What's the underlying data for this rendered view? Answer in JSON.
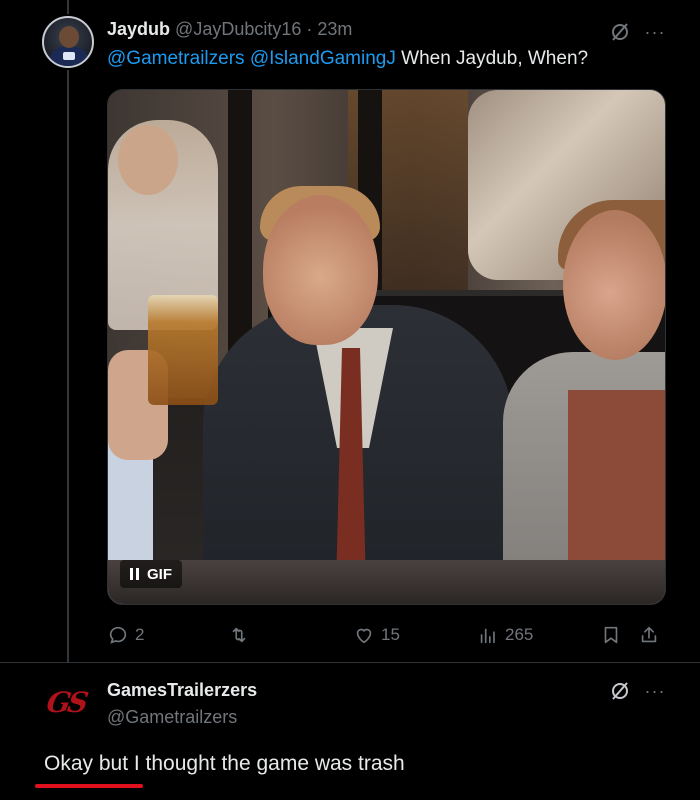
{
  "tweet": {
    "author_name": "Jaydub",
    "author_handle": "@JayDubcity16",
    "separator": "·",
    "time": "23m",
    "mentions": [
      "@Gametrailzers",
      "@IslandGamingJ"
    ],
    "text": "When Jaydub, When?",
    "media": {
      "type": "gif",
      "badge_label": "GIF",
      "control_icon": "pause-icon"
    },
    "actions": {
      "replies": "2",
      "reposts": "",
      "likes": "15",
      "views": "265"
    }
  },
  "reply": {
    "author_name": "GamesTrailerzers",
    "author_handle": "@Gametrailzers",
    "avatar_text": "GS",
    "text": "Okay but I thought the game was trash"
  },
  "colors": {
    "background": "#000000",
    "text": "#e7e9ea",
    "muted": "#71767b",
    "mention": "#1d9bf0",
    "underline": "#e0101c",
    "logo": "#b0121a"
  },
  "icons": {
    "grok": "grok-icon",
    "more": "more-icon",
    "reply": "reply-icon",
    "repost": "repost-icon",
    "like": "heart-icon",
    "views": "views-icon",
    "bookmark": "bookmark-icon",
    "share": "share-icon"
  }
}
